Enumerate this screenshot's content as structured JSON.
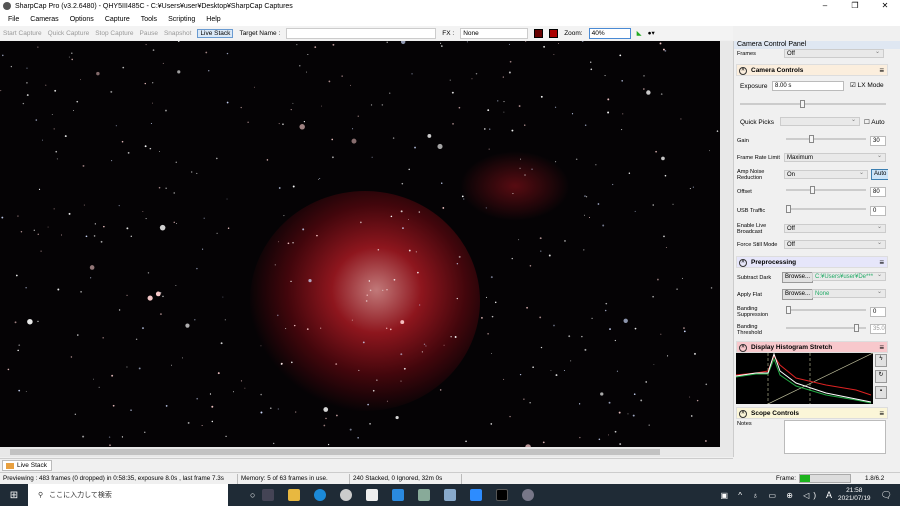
{
  "title": "SharpCap Pro (v3.2.6480) - QHY5III485C - C:¥Users¥user¥Desktop¥SharpCap Captures",
  "menu": [
    "File",
    "Cameras",
    "Options",
    "Capture",
    "Tools",
    "Scripting",
    "Help"
  ],
  "toolbar": {
    "start_capture": "Start Capture",
    "quick_capture": "Quick Capture",
    "stop_capture": "Stop Capture",
    "pause": "Pause",
    "snapshot": "Snapshot",
    "live_stack": "Live Stack",
    "target_label": "Target Name :",
    "target_value": "",
    "fx_label": "FX :",
    "fx_value": "None",
    "zoom_label": "Zoom:",
    "zoom_value": "40%"
  },
  "panel": {
    "title": "Camera Control Panel",
    "frames_label": "Frames",
    "frames_value": "Off",
    "camera_controls": {
      "title": "Camera Controls",
      "exposure_label": "Exposure",
      "exposure_value": "8.00 s",
      "lx_mode": "LX Mode",
      "lx_checked": true,
      "quick_picks": "Quick Picks",
      "auto": "Auto",
      "gain_label": "Gain",
      "gain_value": "30",
      "gain_fraction": 0.3,
      "frame_rate_label": "Frame Rate Limit",
      "frame_rate_value": "Maximum",
      "amp_label": "Amp Noise Reduction",
      "amp_value": "On",
      "amp_auto": "Auto",
      "offset_label": "Offset",
      "offset_value": "80",
      "offset_fraction": 0.32,
      "usb_label": "USB Traffic",
      "usb_value": "0",
      "broadcast_label": "Enable Live Broadcast",
      "broadcast_value": "Off",
      "still_label": "Force Still Mode",
      "still_value": "Off"
    },
    "preprocessing": {
      "title": "Preprocessing",
      "dark_label": "Subtract Dark",
      "browse": "Browse...",
      "dark_value": "C:¥Users¥user¥De***",
      "flat_label": "Apply Flat",
      "flat_value": "None",
      "banding_supp_label": "Banding Suppression",
      "banding_supp_value": "0",
      "banding_thr_label": "Banding Threshold",
      "banding_thr_value": "35.0"
    },
    "histogram": {
      "title": "Display Histogram Stretch"
    },
    "scope": {
      "title": "Scope Controls",
      "notes_label": "Notes"
    }
  },
  "tab": "Live Stack",
  "status": {
    "preview": "Previewing : 483 frames (0 dropped) in 0:58:35, exposure 8.0s , last frame 7.3s",
    "memory": "Memory: 5 of 63 frames in use.",
    "stack": "240 Stacked, 0 Ignored, 32m 0s",
    "frame_label": "Frame:",
    "frame_value": "1.8/6.2"
  },
  "taskbar": {
    "search": "ここに入力して検索",
    "time": "21:58",
    "date": "2021/07/19",
    "ime": "A"
  },
  "colors": {
    "camera_header": "#fbeedd",
    "pre_header": "#e6e6fa",
    "hist_header": "#f8c8cc",
    "scope_header": "#fbf6d8"
  }
}
